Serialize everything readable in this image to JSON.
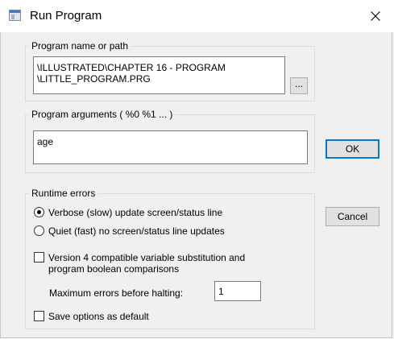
{
  "window": {
    "title": "Run Program",
    "close_icon": "close-icon"
  },
  "program": {
    "group_label": "Program name or path",
    "path_value": "\\ILLUSTRATED\\CHAPTER 16 - PROGRAM\n\\LITTLE_PROGRAM.PRG",
    "browse_label": "..."
  },
  "arguments": {
    "group_label": "Program arguments ( %0  %1 ... )",
    "value": "age"
  },
  "runtime": {
    "group_label": "Runtime errors",
    "verbose_label": "Verbose (slow) update screen/status line",
    "verbose_selected": true,
    "quiet_label": "Quiet (fast) no screen/status line updates",
    "quiet_selected": false,
    "compat_label": "Version 4 compatible variable substitution and\nprogram boolean comparisons",
    "compat_checked": false,
    "max_errors_label": "Maximum errors before halting:",
    "max_errors_value": "1",
    "save_default_label": "Save options as default",
    "save_default_checked": false
  },
  "buttons": {
    "ok": "OK",
    "cancel": "Cancel"
  }
}
